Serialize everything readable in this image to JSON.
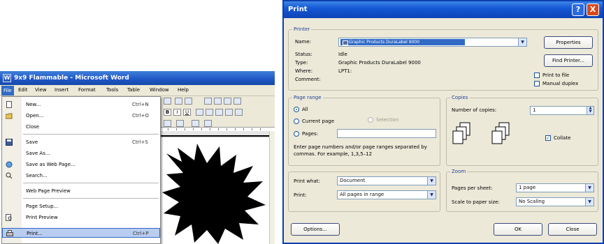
{
  "word": {
    "title": "9x9 Flammable - Microsoft Word",
    "menu": [
      "File",
      "Edit",
      "View",
      "Insert",
      "Format",
      "Tools",
      "Table",
      "Window",
      "Help"
    ],
    "file_menu": [
      {
        "label": "New...",
        "shortcut": "Ctrl+N",
        "icon": "new-document-icon"
      },
      {
        "label": "Open...",
        "shortcut": "Ctrl+O",
        "icon": "open-folder-icon"
      },
      {
        "label": "Close",
        "shortcut": "",
        "icon": ""
      },
      {
        "label": "Save",
        "shortcut": "Ctrl+S",
        "icon": "save-icon"
      },
      {
        "label": "Save As...",
        "shortcut": "",
        "icon": ""
      },
      {
        "label": "Save as Web Page...",
        "shortcut": "",
        "icon": "web-page-icon"
      },
      {
        "label": "Search...",
        "shortcut": "",
        "icon": "search-icon"
      },
      {
        "label": "Web Page Preview",
        "shortcut": "",
        "icon": ""
      },
      {
        "label": "Page Setup...",
        "shortcut": "",
        "icon": ""
      },
      {
        "label": "Print Preview",
        "shortcut": "",
        "icon": "print-preview-icon"
      },
      {
        "label": "Print...",
        "shortcut": "Ctrl+P",
        "icon": "printer-icon"
      }
    ]
  },
  "dialog": {
    "title": "Print",
    "help_glyph": "?",
    "close_glyph": "X",
    "printer": {
      "group": "Printer",
      "name_label": "Name:",
      "name_value": "Graphic Products DuraLabel 9000",
      "properties": "Properties",
      "find_printer": "Find Printer...",
      "status_label": "Status:",
      "status_value": "Idle",
      "type_label": "Type:",
      "type_value": "Graphic Products DuraLabel 9000",
      "where_label": "Where:",
      "where_value": "LPT1:",
      "comment_label": "Comment:",
      "comment_value": "",
      "print_to_file": "Print to file",
      "manual_duplex": "Manual duplex"
    },
    "page_range": {
      "group": "Page range",
      "all": "All",
      "current_page": "Current page",
      "selection": "Selection",
      "pages": "Pages:",
      "pages_value": "",
      "hint": "Enter page numbers and/or page ranges separated by commas. For example, 1,3,5–12"
    },
    "copies": {
      "group": "Copies",
      "number_label": "Number of copies:",
      "number_value": "1",
      "collate": "Collate"
    },
    "print_what": {
      "label": "Print what:",
      "value": "Document"
    },
    "print": {
      "label": "Print:",
      "value": "All pages in range"
    },
    "zoom": {
      "group": "Zoom",
      "pages_per_sheet_label": "Pages per sheet:",
      "pages_per_sheet_value": "1 page",
      "scale_label": "Scale to paper size:",
      "scale_value": "No Scaling"
    },
    "options": "Options...",
    "ok": "OK",
    "close": "Close"
  }
}
